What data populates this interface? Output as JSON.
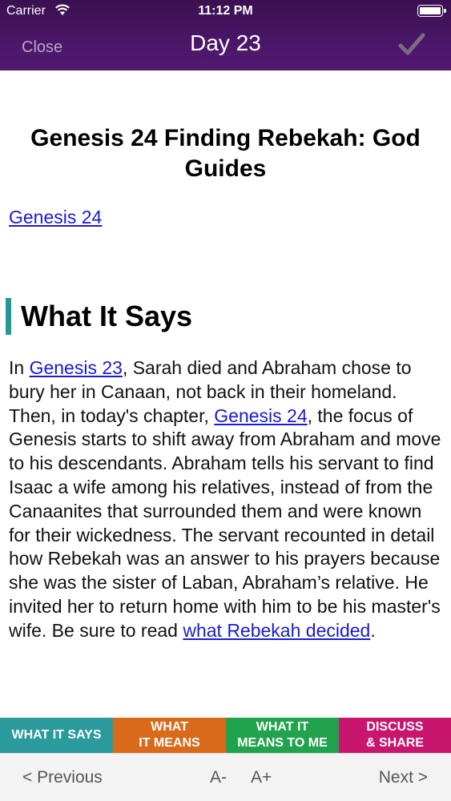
{
  "status_bar": {
    "carrier": "Carrier",
    "time": "11:12 PM",
    "icons": [
      "wifi-icon",
      "battery-icon"
    ]
  },
  "nav": {
    "close_label": "Close",
    "title": "Day 23",
    "check_icon": "checkmark-icon"
  },
  "lesson": {
    "title": "Genesis 24 Finding Rebekah: God Guides",
    "reference_link": "Genesis 24",
    "section_heading": "What It Says",
    "body": {
      "t1": "In ",
      "link1": "Genesis 23",
      "t2": ", Sarah died and Abraham chose to bury her in Canaan, not back in their homeland. Then, in today's chapter, ",
      "link2": "Genesis 24",
      "t3": ", the focus of Genesis starts to shift away from Abraham and move to his descendants. Abraham tells his servant to find Isaac a wife among his relatives, instead of from the Canaanites that surrounded them and were known for their wickedness. The servant recounted in detail how Rebekah was an answer to his prayers because she was the sister of Laban, Abraham’s relative. He invited her to return home with him to be his master's wife. Be sure to read ",
      "link3": "what Rebekah decided",
      "t4": "."
    }
  },
  "tabs": [
    {
      "line1": "WHAT IT SAYS",
      "line2": "",
      "color": "#2a9a9c"
    },
    {
      "line1": "WHAT",
      "line2": "IT MEANS",
      "color": "#d96a1c"
    },
    {
      "line1": "WHAT IT",
      "line2": "MEANS TO ME",
      "color": "#20a34c"
    },
    {
      "line1": "DISCUSS",
      "line2": "& SHARE",
      "color": "#c8166e"
    }
  ],
  "toolbar": {
    "previous_label": "< Previous",
    "font_smaller_label": "A-",
    "font_larger_label": "A+",
    "next_label": "Next >"
  },
  "colors": {
    "header_purple": "#4b1668",
    "link_blue": "#1a1ad6",
    "section_accent": "#1f9a98"
  }
}
